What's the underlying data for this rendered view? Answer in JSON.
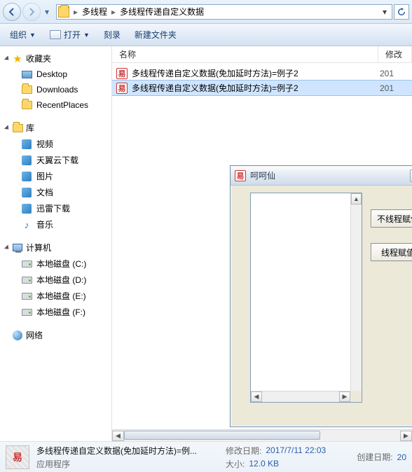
{
  "nav": {
    "crumb1": "多线程",
    "crumb2": "多线程传递自定义数据"
  },
  "toolbar": {
    "organize": "组织",
    "open": "打开",
    "burn": "刻录",
    "newfolder": "新建文件夹"
  },
  "sidebar": {
    "favorites": {
      "title": "收藏夹",
      "items": [
        "Desktop",
        "Downloads",
        "RecentPlaces"
      ]
    },
    "libraries": {
      "title": "库",
      "items": [
        "视频",
        "天翼云下载",
        "图片",
        "文档",
        "迅雷下载",
        "音乐"
      ]
    },
    "computer": {
      "title": "计算机",
      "items": [
        "本地磁盘 (C:)",
        "本地磁盘 (D:)",
        "本地磁盘 (E:)",
        "本地磁盘 (F:)"
      ]
    },
    "network": {
      "title": "网络"
    }
  },
  "columns": {
    "name": "名称",
    "modified": "修改"
  },
  "files": [
    {
      "name": "多线程传递自定义数据(免加延时方法)=例子2",
      "date": "201"
    },
    {
      "name": "多线程传递自定义数据(免加延时方法)=例子2",
      "date": "201"
    }
  ],
  "dialog": {
    "title": "呵呵仙",
    "btn1": "不线程赋值",
    "btn2": "线程赋值"
  },
  "details": {
    "filename": "多线程传递自定义数据(免加延时方法)=例...",
    "filetype": "应用程序",
    "mod_label": "修改日期:",
    "mod_value": "2017/7/11 22:03",
    "size_label": "大小:",
    "size_value": "12.0 KB",
    "created_label": "创建日期:",
    "created_value": "20"
  }
}
